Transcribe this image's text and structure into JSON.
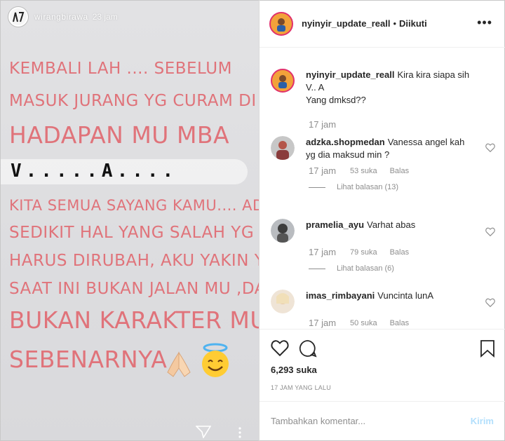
{
  "story": {
    "username": "wirangbirawa",
    "time": "23 jam",
    "lines": [
      "KEMBALI LAH .... SEBELUM",
      "MASUK JURANG YG CURAM DI",
      "HADAPAN MU MBA",
      "KITA SEMUA SAYANG KAMU.... ADA",
      "SEDIKIT HAL YANG SALAH YG",
      "HARUS DIRUBAH, AKU YAKIN YG",
      "SAAT INI BUKAN JALAN MU ,DAN",
      "BUKAN KARAKTER MU",
      "SEBENARNYA"
    ],
    "highlight": "V.....A....",
    "text_color": "#e0737a"
  },
  "post": {
    "username": "nyinyir_update_reall",
    "separator": "•",
    "follow_status": "Diikuti",
    "more_icon": "more-horizontal-icon"
  },
  "caption": {
    "username": "nyinyir_update_reall",
    "text": "Kira kira siapa sih V.. A",
    "text2": "Yang dmksd??",
    "time": "17 jam"
  },
  "comments": [
    {
      "username": "adzka.shopmedan",
      "text": "Vanessa angel kah yg dia maksud min ?",
      "time": "17 jam",
      "likes": "53 suka",
      "reply": "Balas",
      "replies": "Lihat balasan (13)"
    },
    {
      "username": "pramelia_ayu",
      "text": "Varhat abas",
      "time": "17 jam",
      "likes": "79 suka",
      "reply": "Balas",
      "replies": "Lihat balasan (6)"
    },
    {
      "username": "imas_rimbayani",
      "text": "Vuncinta lunA",
      "time": "17 jam",
      "likes": "50 suka",
      "reply": "Balas",
      "replies": ""
    }
  ],
  "actions": {
    "likes": "6,293 suka",
    "posted": "17 JAM YANG LALU"
  },
  "composer": {
    "placeholder": "Tambahkan komentar...",
    "send": "Kirim"
  },
  "colors": {
    "accent_disabled": "#b2dffc",
    "muted": "#8e8e8e",
    "text": "#262626"
  }
}
